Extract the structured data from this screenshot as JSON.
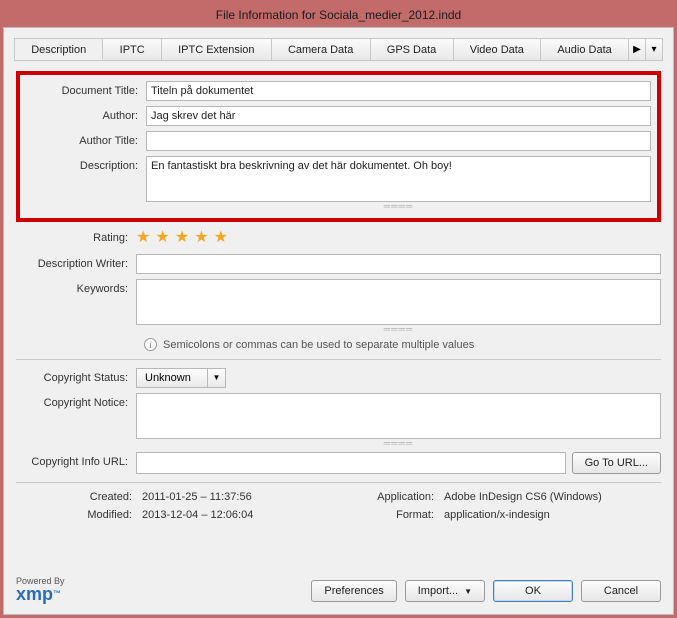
{
  "window": {
    "title": "File Information for Sociala_medier_2012.indd"
  },
  "tabs": {
    "items": [
      {
        "label": "Description",
        "active": true
      },
      {
        "label": "IPTC"
      },
      {
        "label": "IPTC Extension"
      },
      {
        "label": "Camera Data"
      },
      {
        "label": "GPS Data"
      },
      {
        "label": "Video Data"
      },
      {
        "label": "Audio Data"
      }
    ],
    "scroll_glyph": "▶",
    "menu_glyph": "▾"
  },
  "fields": {
    "document_title": {
      "label": "Document Title:",
      "value": "Titeln på dokumentet"
    },
    "author": {
      "label": "Author:",
      "value": "Jag skrev det här"
    },
    "author_title": {
      "label": "Author Title:",
      "value": ""
    },
    "description": {
      "label": "Description:",
      "value": "En fantastiskt bra beskrivning av det här dokumentet. Oh boy!"
    },
    "rating": {
      "label": "Rating:",
      "stars": 5
    },
    "description_writer": {
      "label": "Description Writer:",
      "value": ""
    },
    "keywords": {
      "label": "Keywords:",
      "value": "",
      "hint": "Semicolons or commas can be used to separate multiple values"
    },
    "copyright_status": {
      "label": "Copyright Status:",
      "value": "Unknown"
    },
    "copyright_notice": {
      "label": "Copyright Notice:",
      "value": ""
    },
    "copyright_url": {
      "label": "Copyright Info URL:",
      "value": "",
      "go_button": "Go To URL..."
    }
  },
  "meta": {
    "created": {
      "label": "Created:",
      "value": "2011-01-25 – 11:37:56"
    },
    "modified": {
      "label": "Modified:",
      "value": "2013-12-04 – 12:06:04"
    },
    "application": {
      "label": "Application:",
      "value": "Adobe InDesign CS6 (Windows)"
    },
    "format": {
      "label": "Format:",
      "value": "application/x-indesign"
    }
  },
  "footer": {
    "powered_by": "Powered By",
    "logo": "xmp",
    "buttons": {
      "preferences": "Preferences",
      "import": "Import...",
      "ok": "OK",
      "cancel": "Cancel"
    }
  }
}
